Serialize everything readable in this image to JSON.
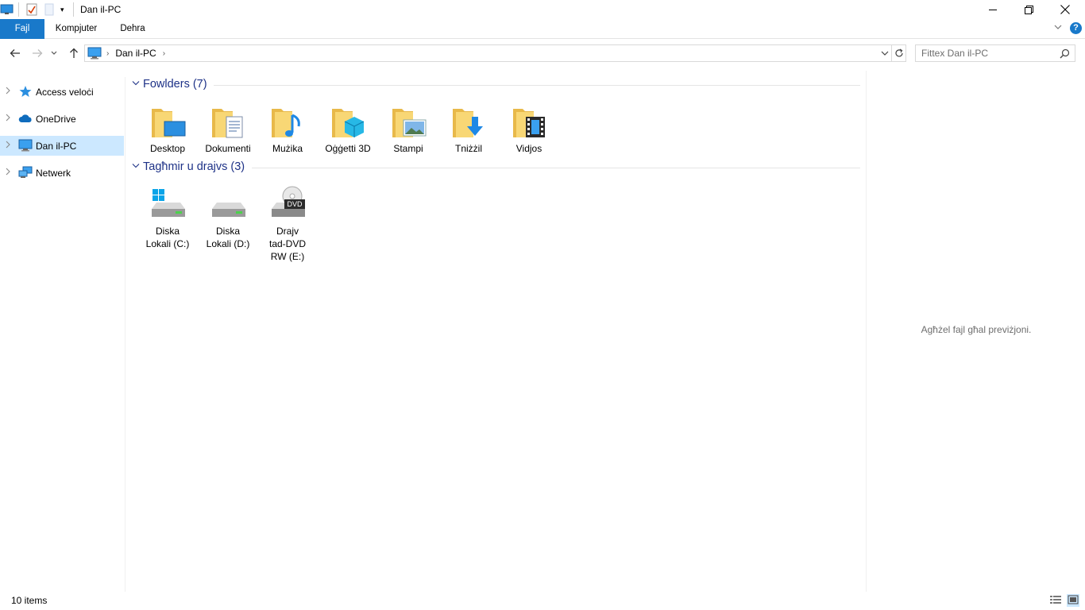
{
  "window": {
    "title": "Dan il-PC",
    "minimize_icon": "minimize-icon",
    "maximize_icon": "restore-icon",
    "close_icon": "close-icon"
  },
  "ribbon": {
    "tabs": [
      {
        "label": "Fajl",
        "active": true
      },
      {
        "label": "Kompjuter",
        "active": false
      },
      {
        "label": "Dehra",
        "active": false
      }
    ]
  },
  "address": {
    "path": "Dan il-PC",
    "search_placeholder": "Fittex Dan il-PC"
  },
  "nav": {
    "items": [
      {
        "label": "Access veloċi",
        "icon": "star-icon",
        "selected": false
      },
      {
        "label": "OneDrive",
        "icon": "cloud-icon",
        "selected": false
      },
      {
        "label": "Dan il-PC",
        "icon": "computer-icon",
        "selected": true
      },
      {
        "label": "Netwerk",
        "icon": "network-icon",
        "selected": false
      }
    ]
  },
  "groups": {
    "folders": {
      "title": "Fowlders (7)",
      "items": [
        {
          "label": "Desktop",
          "icon": "desktop-folder-icon"
        },
        {
          "label": "Dokumenti",
          "icon": "documents-folder-icon"
        },
        {
          "label": "Mużika",
          "icon": "music-folder-icon"
        },
        {
          "label": "Oġġetti 3D",
          "icon": "3d-objects-folder-icon"
        },
        {
          "label": "Stampi",
          "icon": "pictures-folder-icon"
        },
        {
          "label": "Tniżżil",
          "icon": "downloads-folder-icon"
        },
        {
          "label": "Vidjos",
          "icon": "videos-folder-icon"
        }
      ]
    },
    "drives": {
      "title": "Tagħmir u drajvs (3)",
      "items": [
        {
          "line1": "Diska",
          "line2": "Lokali (C:)",
          "line3": "",
          "icon": "system-drive-icon"
        },
        {
          "line1": "Diska",
          "line2": "Lokali (D:)",
          "line3": "",
          "icon": "hard-drive-icon"
        },
        {
          "line1": "Drajv",
          "line2": "tad-DVD",
          "line3": "RW (E:)",
          "icon": "dvd-drive-icon",
          "badge": "DVD"
        }
      ]
    }
  },
  "preview": {
    "message": "Agħżel fajl għal previżjoni."
  },
  "status": {
    "count": "10 items"
  },
  "colors": {
    "accent": "#1979ca",
    "selected_bg": "#cce8ff",
    "group_header": "#1e3287",
    "folder": "#f8d775"
  }
}
